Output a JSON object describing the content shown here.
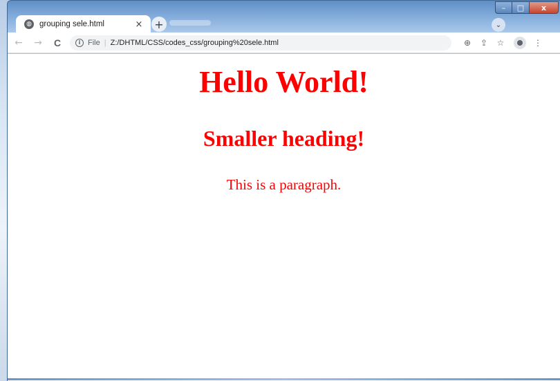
{
  "tab": {
    "title": "grouping sele.html",
    "close_glyph": "×",
    "favicon": "globe-icon"
  },
  "new_tab_glyph": "+",
  "tab_search_glyph": "⌄",
  "window_controls": {
    "minimize": "–",
    "maximize": "□",
    "close": "x"
  },
  "toolbar": {
    "back": "←",
    "forward": "→",
    "reload": "C",
    "info_glyph": "i",
    "scheme": "File",
    "separator": "|",
    "url": "Z:/DHTML/CSS/codes_css/grouping%20sele.html",
    "zoom_glyph": "⊕",
    "share_glyph": "⇪",
    "bookmark_glyph": "☆",
    "menu_glyph": "⋮"
  },
  "content": {
    "heading1": "Hello World!",
    "heading2": "Smaller heading!",
    "paragraph": "This is a paragraph.",
    "text_color": "#ff0000"
  }
}
